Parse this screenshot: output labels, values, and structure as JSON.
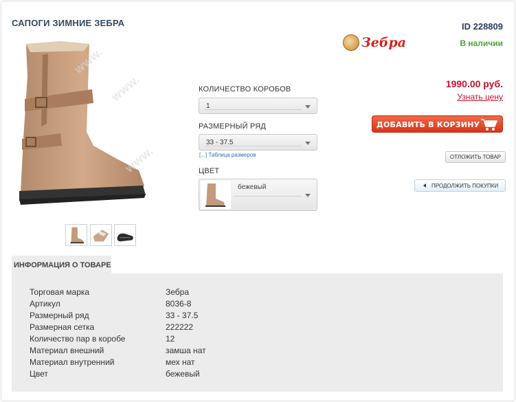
{
  "product": {
    "title": "САПОГИ ЗИМНИЕ ЗЕБРА",
    "id_label": "ID 228809",
    "stock_status": "В наличии",
    "brand_logo_text": "Зебра",
    "price": "1990.00 руб.",
    "ask_price_link": "Узнать цену",
    "thumbnails": [
      "boot-side",
      "boot-top",
      "boot-sole"
    ]
  },
  "options": {
    "box_count": {
      "label": "КОЛИЧЕСТВО КОРОБОВ",
      "selected": "1"
    },
    "size_range": {
      "label": "РАЗМЕРНЫЙ РЯД",
      "selected": "33 - 37.5",
      "table_link": "[...] Таблица размеров"
    },
    "color": {
      "label": "ЦВЕТ",
      "selected": "бежевый"
    }
  },
  "actions": {
    "add_to_cart": "ДОБАВИТЬ В КОРЗИНУ",
    "defer": "ОТЛОЖИТЬ ТОВАР",
    "continue": "ПРОДОЛЖИТЬ ПОКУПКИ"
  },
  "info": {
    "tab_label": "ИНФОРМАЦИЯ О ТОВАРЕ",
    "rows": [
      {
        "key": "Торговая марка",
        "value": "Зебра"
      },
      {
        "key": "Артикул",
        "value": "8036-8"
      },
      {
        "key": "Размерный ряд",
        "value": "33 - 37.5"
      },
      {
        "key": "Размерная сетка",
        "value": "222222"
      },
      {
        "key": "Количество пар в коробе",
        "value": "12"
      },
      {
        "key": "Материал внешний",
        "value": "замша нат"
      },
      {
        "key": "Материал внутренний",
        "value": "мех нат"
      },
      {
        "key": "Цвет",
        "value": "бежевый"
      }
    ]
  },
  "colors": {
    "title": "#34495e",
    "in_stock": "#4ba33a",
    "price": "#c8102e",
    "cart_button": "#e0452a",
    "panel": "#ececec"
  }
}
